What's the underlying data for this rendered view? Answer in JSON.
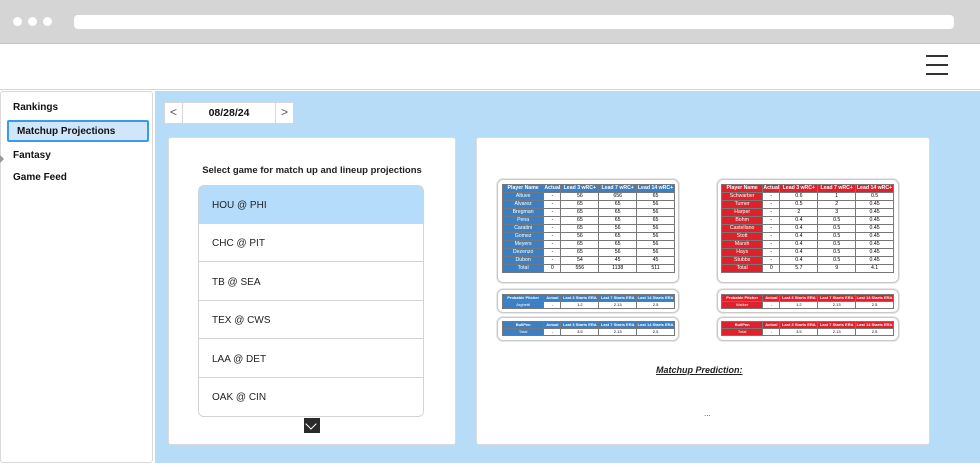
{
  "sidebar": {
    "items": [
      {
        "label": "Rankings"
      },
      {
        "label": "Matchup Projections"
      },
      {
        "label": "Fantasy"
      },
      {
        "label": "Game Feed"
      }
    ]
  },
  "date_nav": {
    "prev": "<",
    "next": ">",
    "date": "08/28/24"
  },
  "games": {
    "title": "Select game for match up and lineup projections",
    "items": [
      "HOU @ PHI",
      "CHC @ PIT",
      "TB @ SEA",
      "TEX @ CWS",
      "LAA @ DET",
      "OAK @ CIN"
    ]
  },
  "home_team": {
    "batters": {
      "headers": [
        "Player Name",
        "Actual",
        "Lead 3 wRC+",
        "Lead 7 wRC+",
        "Lead 14 wRC+"
      ],
      "rows": [
        [
          "Altuve",
          "-",
          "56",
          "656",
          "65"
        ],
        [
          "Alvarez",
          "-",
          "65",
          "65",
          "56"
        ],
        [
          "Bregman",
          "-",
          "65",
          "65",
          "56"
        ],
        [
          "Pena",
          "-",
          "65",
          "65",
          "65"
        ],
        [
          "Caratini",
          "-",
          "65",
          "56",
          "56"
        ],
        [
          "Gomez",
          "-",
          "56",
          "65",
          "56"
        ],
        [
          "Meyers",
          "-",
          "65",
          "65",
          "56"
        ],
        [
          "Dezenzo",
          "-",
          "65",
          "56",
          "56"
        ],
        [
          "Dubon",
          "-",
          "54",
          "45",
          "45"
        ],
        [
          "Total",
          "0",
          "556",
          "1138",
          "511"
        ]
      ]
    },
    "pitcher": {
      "headers": [
        "Probable Pitcher",
        "Actual",
        "Last 3 Starts ERA",
        "Last 7 Starts ERA",
        "Last 14 Starts ERA"
      ],
      "rows": [
        [
          "Arghetti",
          "-",
          "1.2",
          "2.13",
          "2.5"
        ]
      ]
    },
    "bullpen": {
      "headers": [
        "BullPen",
        "Actual",
        "Last 3 Starts ERA",
        "Last 7 Starts ERA",
        "Last 14 Starts ERA"
      ],
      "rows": [
        [
          "Total",
          "-",
          "3.5",
          "2.13",
          "2.5"
        ]
      ]
    }
  },
  "away_team": {
    "batters": {
      "headers": [
        "Player Name",
        "Actual",
        "Lead 3 wRC+",
        "Lead 7 wRC+",
        "Lead 14 wRC+"
      ],
      "rows": [
        [
          "Schwarber",
          "-",
          "0.6",
          "1",
          "0.5"
        ],
        [
          "Turner",
          "-",
          "0.5",
          "2",
          "0.45"
        ],
        [
          "Harper",
          "-",
          "2",
          "3",
          "0.45"
        ],
        [
          "Bohm",
          "-",
          "0.4",
          "0.5",
          "0.45"
        ],
        [
          "Castellano",
          "-",
          "0.4",
          "0.5",
          "0.45"
        ],
        [
          "Stott",
          "-",
          "0.4",
          "0.5",
          "0.45"
        ],
        [
          "Marsh",
          "-",
          "0.4",
          "0.5",
          "0.45"
        ],
        [
          "Hays",
          "-",
          "0.4",
          "0.5",
          "0.45"
        ],
        [
          "Stubbs",
          "-",
          "0.4",
          "0.5",
          "0.45"
        ],
        [
          "Total",
          "0",
          "5.7",
          "9",
          "4.1"
        ]
      ]
    },
    "pitcher": {
      "headers": [
        "Probable Pitcher",
        "Actual",
        "Last 3 Starts ERA",
        "Last 7 Starts ERA",
        "Last 14 Starts ERA"
      ],
      "rows": [
        [
          "Walker",
          "-",
          "1.2",
          "2.13",
          "2.5"
        ]
      ]
    },
    "bullpen": {
      "headers": [
        "BullPen",
        "Actual",
        "Last 3 Starts ERA",
        "Last 7 Starts ERA",
        "Last 14 Starts ERA"
      ],
      "rows": [
        [
          "Total",
          "-",
          "3.5",
          "2.13",
          "2.5"
        ]
      ]
    }
  },
  "prediction": {
    "label": "Matchup Prediction:",
    "value": "..."
  },
  "colors": {
    "home": "#3b7fc4",
    "away": "#e0202a",
    "main_bg": "#b7dcf8",
    "selected": "#b5dcfa",
    "active_border": "#3c9be8"
  }
}
